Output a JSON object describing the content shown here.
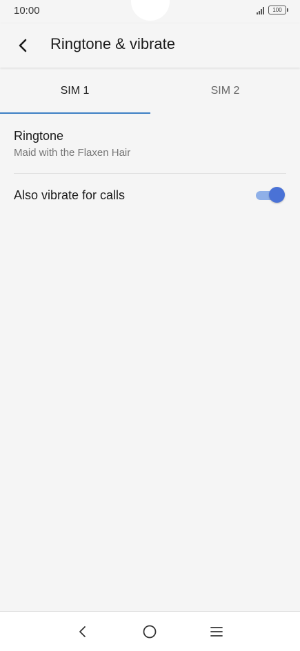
{
  "status_bar": {
    "time": "10:00",
    "battery": "100"
  },
  "app_bar": {
    "title": "Ringtone & vibrate",
    "back_icon": "chevron-left-icon"
  },
  "tabs": [
    {
      "label": "SIM 1",
      "selected": true
    },
    {
      "label": "SIM 2",
      "selected": false
    }
  ],
  "settings": {
    "ringtone": {
      "title": "Ringtone",
      "value": "Maid with the Flaxen Hair"
    },
    "vibrate": {
      "title": "Also vibrate for calls",
      "enabled": true
    }
  },
  "nav_bar": {
    "back_icon": "nav-back-icon",
    "home_icon": "nav-home-icon",
    "menu_icon": "nav-menu-icon"
  },
  "colors": {
    "accent": "#3d7fc4",
    "toggle_thumb": "#4a72d6",
    "toggle_track": "#8fb0e8",
    "background": "#f5f5f5"
  }
}
